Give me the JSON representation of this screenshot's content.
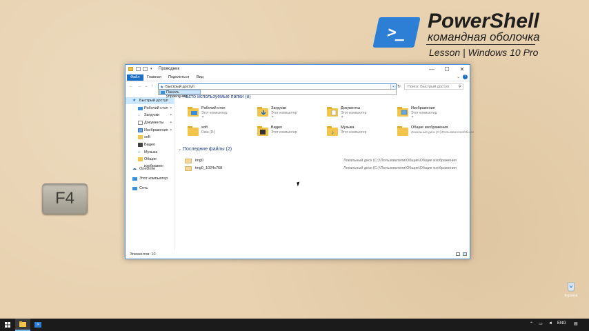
{
  "brand": {
    "logo_glyph": ">_",
    "title": "PowerShell",
    "subtitle": "командная оболочка",
    "lesson": "Lesson | Windows 10 Pro"
  },
  "key": {
    "label": "F4"
  },
  "window": {
    "title": "Проводник",
    "controls": {
      "minimize": "—",
      "maximize": "☐",
      "close": "✕"
    },
    "ribbon_tabs": [
      "Файл",
      "Главная",
      "Поделиться",
      "Вид"
    ],
    "address": {
      "value": "Быстрый доступ",
      "dropdown_item": "Панель управления"
    },
    "search": {
      "placeholder": "Поиск: Быстрый доступ"
    },
    "sidebar": [
      {
        "label": "Быстрый доступ",
        "icon": "star-icon",
        "selected": true
      },
      {
        "label": "Рабочий стол",
        "icon": "desktop-icon",
        "pinned": true
      },
      {
        "label": "Загрузки",
        "icon": "download-icon",
        "pinned": true
      },
      {
        "label": "Документы",
        "icon": "documents-icon",
        "pinned": true
      },
      {
        "label": "Изображения",
        "icon": "pictures-icon",
        "pinned": true
      },
      {
        "label": "soft",
        "icon": "folder-icon"
      },
      {
        "label": "Видео",
        "icon": "video-icon"
      },
      {
        "label": "Музыка",
        "icon": "music-icon"
      },
      {
        "label": "Общие изображен",
        "icon": "folder-icon"
      },
      {
        "label": "OneDrive",
        "icon": "cloud-icon"
      },
      {
        "label": "Этот компьютер",
        "icon": "computer-icon"
      },
      {
        "label": "Сеть",
        "icon": "network-icon"
      }
    ],
    "frequent_header": "Часто используемые папки (8)",
    "frequent": [
      {
        "name": "Рабочий стол",
        "sub": "Этот компьютер",
        "pin": "✦"
      },
      {
        "name": "Загрузки",
        "sub": "Этот компьютер",
        "pin": "✦"
      },
      {
        "name": "Документы",
        "sub": "Этот компьютер",
        "pin": "✦"
      },
      {
        "name": "Изображения",
        "sub": "Этот компьютер",
        "pin": "✦"
      },
      {
        "name": "soft",
        "sub": "Data (D:)",
        "pin": ""
      },
      {
        "name": "Видео",
        "sub": "Этот компьютер",
        "pin": ""
      },
      {
        "name": "Музыка",
        "sub": "Этот компьютер",
        "pin": ""
      },
      {
        "name": "Общие изображения",
        "sub": "Локальный диск (C:)\\Пользователи\\Общие",
        "pin": ""
      }
    ],
    "recent_header": "Последние файлы (2)",
    "recent": [
      {
        "name": "img0",
        "path": "Локальный диск (C:)\\Пользователи\\Общие\\Общие изображения"
      },
      {
        "name": "img0_1024x768",
        "path": "Локальный диск (C:)\\Пользователи\\Общие\\Общие изображения"
      }
    ],
    "status": "Элементов: 10"
  },
  "desktop": {
    "recycle_label": "Корзина"
  },
  "taskbar": {
    "lang": "ENG"
  },
  "colors": {
    "accent": "#1a6fc4",
    "taskbar": "#1b1b1b",
    "folder": "#f2c64c"
  }
}
